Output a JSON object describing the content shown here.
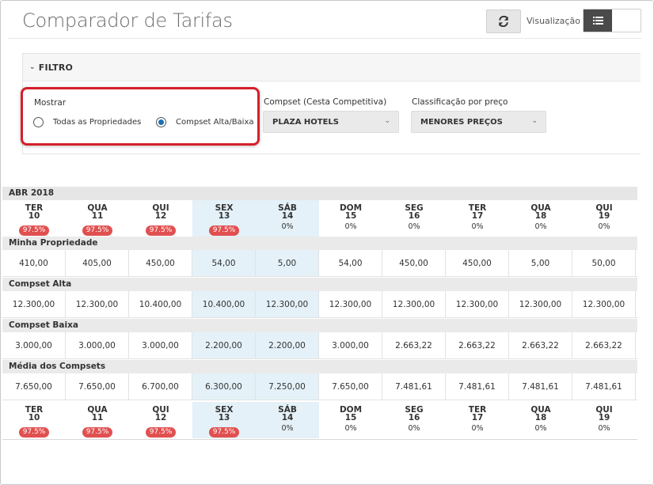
{
  "header": {
    "title": "Comparador de Tarifas",
    "visualizacao_label": "Visualização"
  },
  "filter": {
    "heading": "FILTRO",
    "mostrar": {
      "label": "Mostrar",
      "options": [
        "Todas as Propriedades",
        "Compset Alta/Baixa"
      ],
      "selected": "Compset Alta/Baixa"
    },
    "compset": {
      "label": "Compset (Cesta Competitiva)",
      "value": "PLAZA HOTELS"
    },
    "classificacao": {
      "label": "Classificação por preço",
      "value": "MENORES PREÇOS"
    }
  },
  "table": {
    "month": "ABR 2018",
    "days": [
      {
        "dow": "TER",
        "num": "10",
        "pct": "97.5%",
        "alert": true
      },
      {
        "dow": "QUA",
        "num": "11",
        "pct": "97.5%",
        "alert": true
      },
      {
        "dow": "QUI",
        "num": "12",
        "pct": "97.5%",
        "alert": true
      },
      {
        "dow": "SEX",
        "num": "13",
        "pct": "97.5%",
        "alert": true
      },
      {
        "dow": "SÁB",
        "num": "14",
        "pct": "0%",
        "alert": false
      },
      {
        "dow": "DOM",
        "num": "15",
        "pct": "0%",
        "alert": false
      },
      {
        "dow": "SEG",
        "num": "16",
        "pct": "0%",
        "alert": false
      },
      {
        "dow": "TER",
        "num": "17",
        "pct": "0%",
        "alert": false
      },
      {
        "dow": "QUA",
        "num": "18",
        "pct": "0%",
        "alert": false
      },
      {
        "dow": "QUI",
        "num": "19",
        "pct": "0%",
        "alert": false
      }
    ],
    "sections": [
      {
        "title": "Minha Propriedade",
        "values": [
          "410,00",
          "405,00",
          "450,00",
          "54,00",
          "5,00",
          "54,00",
          "450,00",
          "450,00",
          "5,00",
          "50,00"
        ]
      },
      {
        "title": "Compset Alta",
        "values": [
          "12.300,00",
          "12.300,00",
          "10.400,00",
          "10.400,00",
          "12.300,00",
          "12.300,00",
          "12.300,00",
          "12.300,00",
          "12.300,00",
          "12.300,00"
        ]
      },
      {
        "title": "Compset Baixa",
        "values": [
          "3.000,00",
          "3.000,00",
          "3.000,00",
          "2.200,00",
          "2.200,00",
          "3.000,00",
          "2.663,22",
          "2.663,22",
          "2.663,22",
          "2.663,22"
        ]
      },
      {
        "title": "Média dos Compsets",
        "values": [
          "7.650,00",
          "7.650,00",
          "6.700,00",
          "6.300,00",
          "7.250,00",
          "7.650,00",
          "7.481,61",
          "7.481,61",
          "7.481,61",
          "7.481,61"
        ]
      }
    ]
  },
  "colors": {
    "alert_pill": "#e15050",
    "weekend_highlight": "#e4f1f8",
    "radio_selected": "#1a6fb5",
    "highlight_border": "#d4202a"
  }
}
